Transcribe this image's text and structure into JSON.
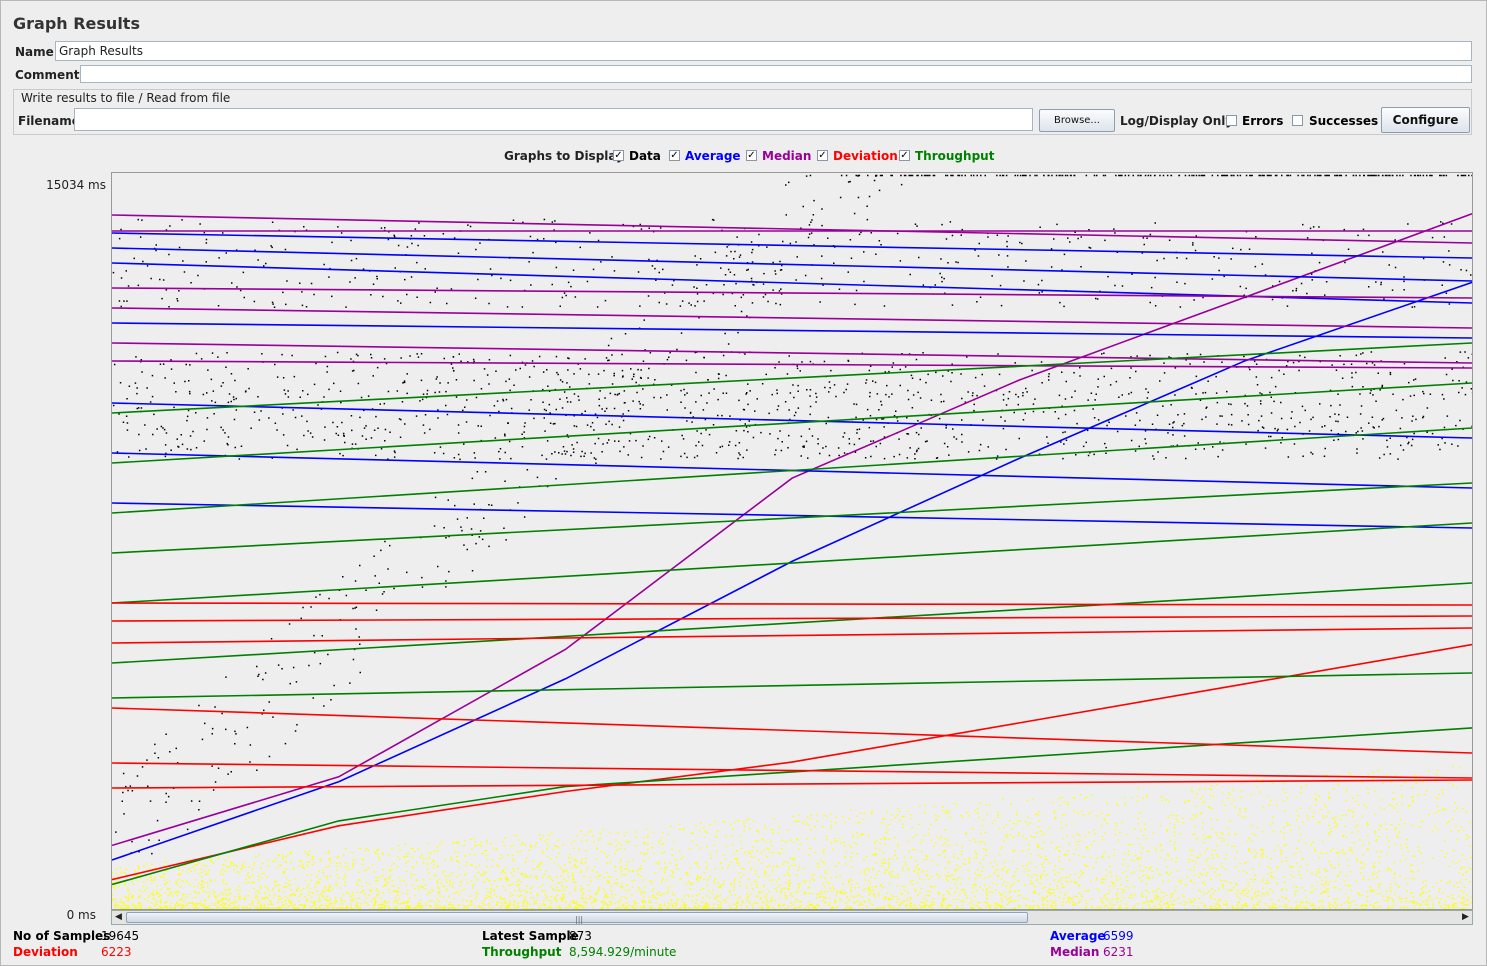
{
  "window": {
    "title": "Graph Results"
  },
  "form": {
    "name_label": "Name:",
    "name_value": "Graph Results",
    "comments_label": "Comments:",
    "comments_value": ""
  },
  "file_group": {
    "title": "Write results to file / Read from file",
    "filename_label": "Filename",
    "filename_value": "",
    "browse_label": "Browse...",
    "log_display_label": "Log/Display Only:",
    "errors_label": "Errors",
    "errors_checked": false,
    "successes_label": "Successes",
    "successes_checked": false,
    "configure_label": "Configure"
  },
  "graphs_to_display": {
    "label": "Graphs to Display",
    "items": [
      {
        "label": "Data",
        "checked": true,
        "color": "#000000"
      },
      {
        "label": "Average",
        "checked": true,
        "color": "#0000ff"
      },
      {
        "label": "Median",
        "checked": true,
        "color": "#990099"
      },
      {
        "label": "Deviation",
        "checked": true,
        "color": "#ff0000"
      },
      {
        "label": "Throughput",
        "checked": true,
        "color": "#008000"
      }
    ]
  },
  "chart": {
    "y_max_label": "15034  ms",
    "y_min_label": "0  ms"
  },
  "chart_data": {
    "type": "scatter",
    "ylim": [
      0,
      15034
    ],
    "series_colors": {
      "data": "#000000",
      "average": "#0000ff",
      "median": "#990099",
      "deviation": "#ff0000",
      "throughput": "#008000",
      "samples": "#ffff00"
    },
    "series": [
      {
        "name": "Average",
        "values": [
          1000,
          2600,
          4700,
          7100,
          9200,
          11200,
          12800
        ]
      },
      {
        "name": "Median",
        "values": [
          1300,
          2700,
          5300,
          8800,
          10800,
          12500,
          14200
        ]
      },
      {
        "name": "Deviation",
        "values": [
          600,
          1700,
          2400,
          3000,
          3800,
          4600,
          5400
        ]
      },
      {
        "name": "Throughput",
        "values": [
          500,
          1800,
          2500,
          2800,
          3100,
          3400,
          3700
        ]
      }
    ]
  },
  "stats": {
    "samples_label": "No of Samples",
    "samples_value": "19645",
    "latest_label": "Latest Sample",
    "latest_value": "873",
    "average_label": "Average",
    "average_value": "6599",
    "deviation_label": "Deviation",
    "deviation_value": "6223",
    "throughput_label": "Throughput",
    "throughput_value": "8,594.929/minute",
    "median_label": "Median",
    "median_value": "6231"
  }
}
